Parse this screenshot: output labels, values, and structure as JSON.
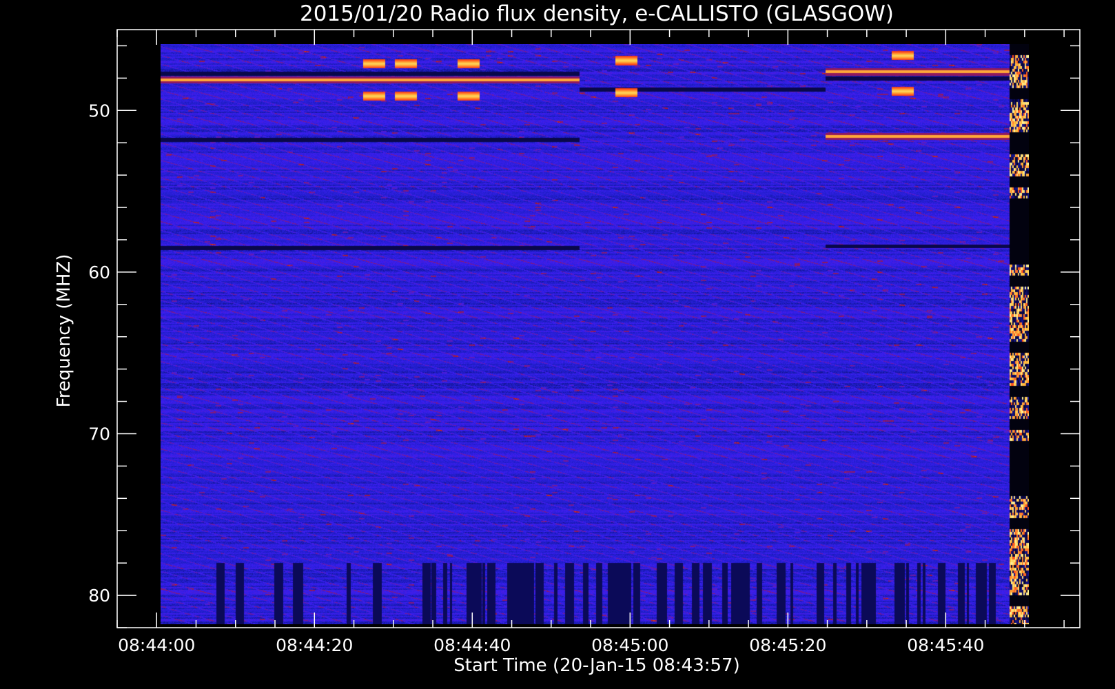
{
  "chart_data": {
    "type": "heatmap",
    "title": "2015/01/20  Radio flux density, e-CALLISTO (GLASGOW)",
    "xlabel": "Start Time (20-Jan-15 08:43:57)",
    "ylabel": "Frequency (MHZ)",
    "x_start": "08:43:57",
    "x_ticks": [
      "08:44:00",
      "08:44:20",
      "08:44:40",
      "08:45:00",
      "08:45:20",
      "08:45:40"
    ],
    "x_tick_seconds": [
      3,
      23,
      43,
      63,
      83,
      103
    ],
    "xlim_seconds": [
      -2,
      120
    ],
    "y_ticks": [
      50,
      60,
      70,
      80
    ],
    "ylim": [
      45,
      82
    ],
    "y_reversed": true,
    "data_extent": {
      "t_start_seconds": 3.5,
      "t_end_seconds": 113.5,
      "f_min": 45.9,
      "f_max": 81.8
    },
    "colormap": [
      "#000000",
      "#0b0a5c",
      "#1e1ec8",
      "#3c1ef2",
      "#7a1a8c",
      "#b01a1a",
      "#ff4a1a",
      "#ffc040",
      "#fff8a0"
    ],
    "segments": [
      {
        "t_start_seconds": 3.5,
        "t_end_seconds": 56.5,
        "bright_lines_mhz": [
          48.1
        ],
        "dark_lines_mhz": [
          47.7,
          51.8,
          58.5
        ]
      },
      {
        "t_start_seconds": 56.5,
        "t_end_seconds": 87.7,
        "bright_lines_mhz": [],
        "dark_lines_mhz": [
          48.7
        ]
      },
      {
        "t_start_seconds": 87.7,
        "t_end_seconds": 111.0,
        "bright_lines_mhz": [
          47.6,
          51.6
        ],
        "dark_lines_mhz": [
          48.0,
          58.4
        ]
      }
    ],
    "hot_spots": [
      {
        "t_seconds": 30.5,
        "f_mhz": 47.1
      },
      {
        "t_seconds": 34.5,
        "f_mhz": 47.1
      },
      {
        "t_seconds": 42.5,
        "f_mhz": 47.1
      },
      {
        "t_seconds": 30.5,
        "f_mhz": 49.1
      },
      {
        "t_seconds": 34.5,
        "f_mhz": 49.1
      },
      {
        "t_seconds": 42.5,
        "f_mhz": 49.1
      },
      {
        "t_seconds": 62.5,
        "f_mhz": 46.9
      },
      {
        "t_seconds": 62.5,
        "f_mhz": 48.9
      },
      {
        "t_seconds": 97.5,
        "f_mhz": 46.6
      },
      {
        "t_seconds": 97.5,
        "f_mhz": 48.8
      }
    ],
    "saturated_strip_seconds": [
      111.0,
      114.0
    ]
  }
}
